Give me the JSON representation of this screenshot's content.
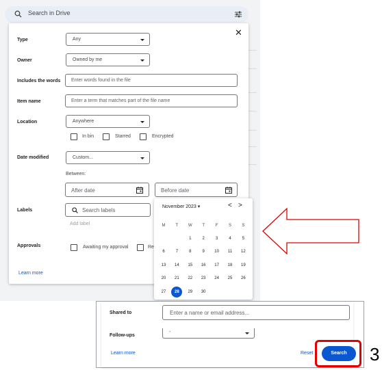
{
  "search": {
    "placeholder": "Search in Drive"
  },
  "panel": {
    "fields": {
      "type": {
        "label": "Type",
        "value": "Any"
      },
      "owner": {
        "label": "Owner",
        "value": "Owned by me"
      },
      "includes": {
        "label": "Includes the words",
        "placeholder": "Enter words found in the file"
      },
      "item_name": {
        "label": "Item name",
        "placeholder": "Enter a term that matches part of the file name"
      },
      "location": {
        "label": "Location",
        "value": "Anywhere",
        "checkboxes": [
          "In bin",
          "Starred",
          "Encrypted"
        ]
      },
      "date_modified": {
        "label": "Date modified",
        "value": "Custom...",
        "between": "Between:",
        "after": "After date",
        "before": "Before date"
      },
      "labels": {
        "label": "Labels",
        "placeholder": "Search labels",
        "add": "Add label"
      },
      "approvals": {
        "label": "Approvals",
        "options": [
          "Awaiting my approval",
          "Re"
        ]
      }
    },
    "learn_more": "Learn more"
  },
  "calendar": {
    "month_label": "November 2023",
    "prev": "<",
    "next": ">",
    "weekdays": [
      "M",
      "T",
      "W",
      "T",
      "F",
      "S",
      "S"
    ],
    "weeks": [
      [
        "",
        "",
        "1",
        "2",
        "3",
        "4",
        "5"
      ],
      [
        "6",
        "7",
        "8",
        "9",
        "10",
        "11",
        "12"
      ],
      [
        "13",
        "14",
        "15",
        "16",
        "17",
        "18",
        "19"
      ],
      [
        "20",
        "21",
        "22",
        "23",
        "24",
        "25",
        "26"
      ],
      [
        "27",
        "28",
        "29",
        "30",
        "",
        "",
        ""
      ]
    ],
    "selected": "28"
  },
  "lower": {
    "shared_to": {
      "label": "Shared to",
      "placeholder": "Enter a name or email address..."
    },
    "follow_ups": {
      "label": "Follow-ups",
      "value": "-"
    },
    "learn_more": "Learn more",
    "reset": "Reset",
    "search": "Search"
  },
  "annotation": {
    "step": "3"
  },
  "colors": {
    "accent": "#0b57d0",
    "highlight": "#e00000"
  }
}
